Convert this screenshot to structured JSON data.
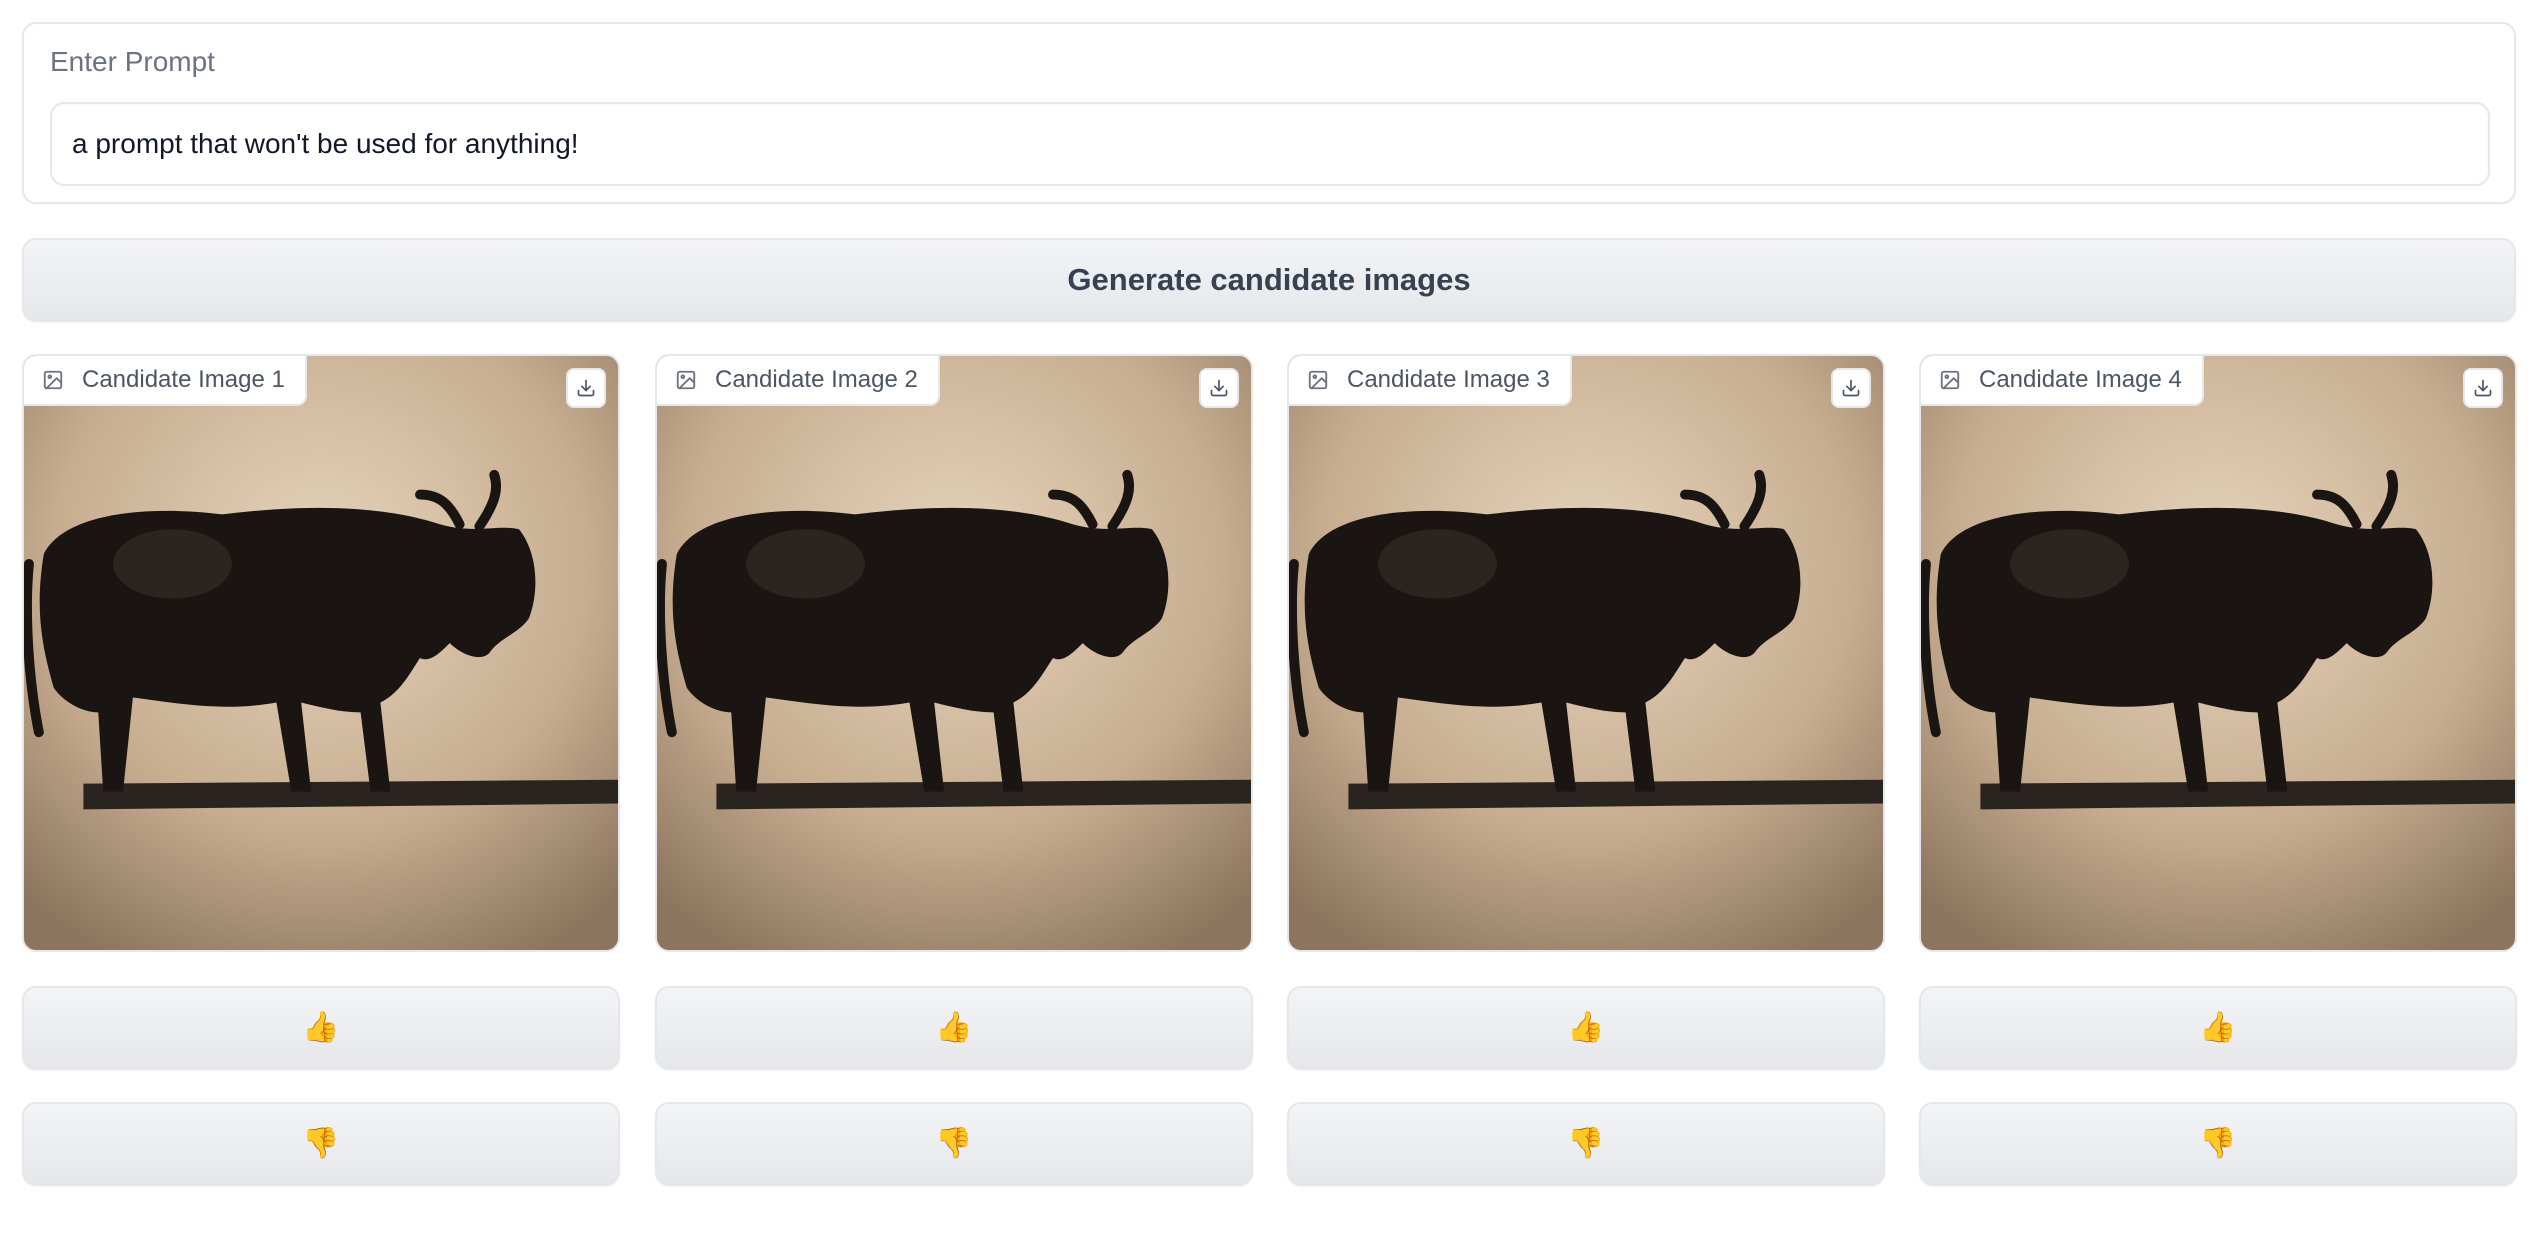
{
  "prompt": {
    "label": "Enter Prompt",
    "value": "a prompt that won't be used for anything!"
  },
  "generate_button": {
    "label": "Generate candidate images"
  },
  "candidates": [
    {
      "label": "Candidate Image 1",
      "like": "👍",
      "dislike": "👎"
    },
    {
      "label": "Candidate Image 2",
      "like": "👍",
      "dislike": "👎"
    },
    {
      "label": "Candidate Image 3",
      "like": "👍",
      "dislike": "👎"
    },
    {
      "label": "Candidate Image 4",
      "like": "👍",
      "dislike": "👎"
    }
  ],
  "icons": {
    "image": "image-icon",
    "download": "download-icon"
  },
  "colors": {
    "border": "#e5e7eb",
    "button_bg": "#e5e7eb",
    "label_text": "#6b7280",
    "photo_bg": "#c9b298"
  }
}
